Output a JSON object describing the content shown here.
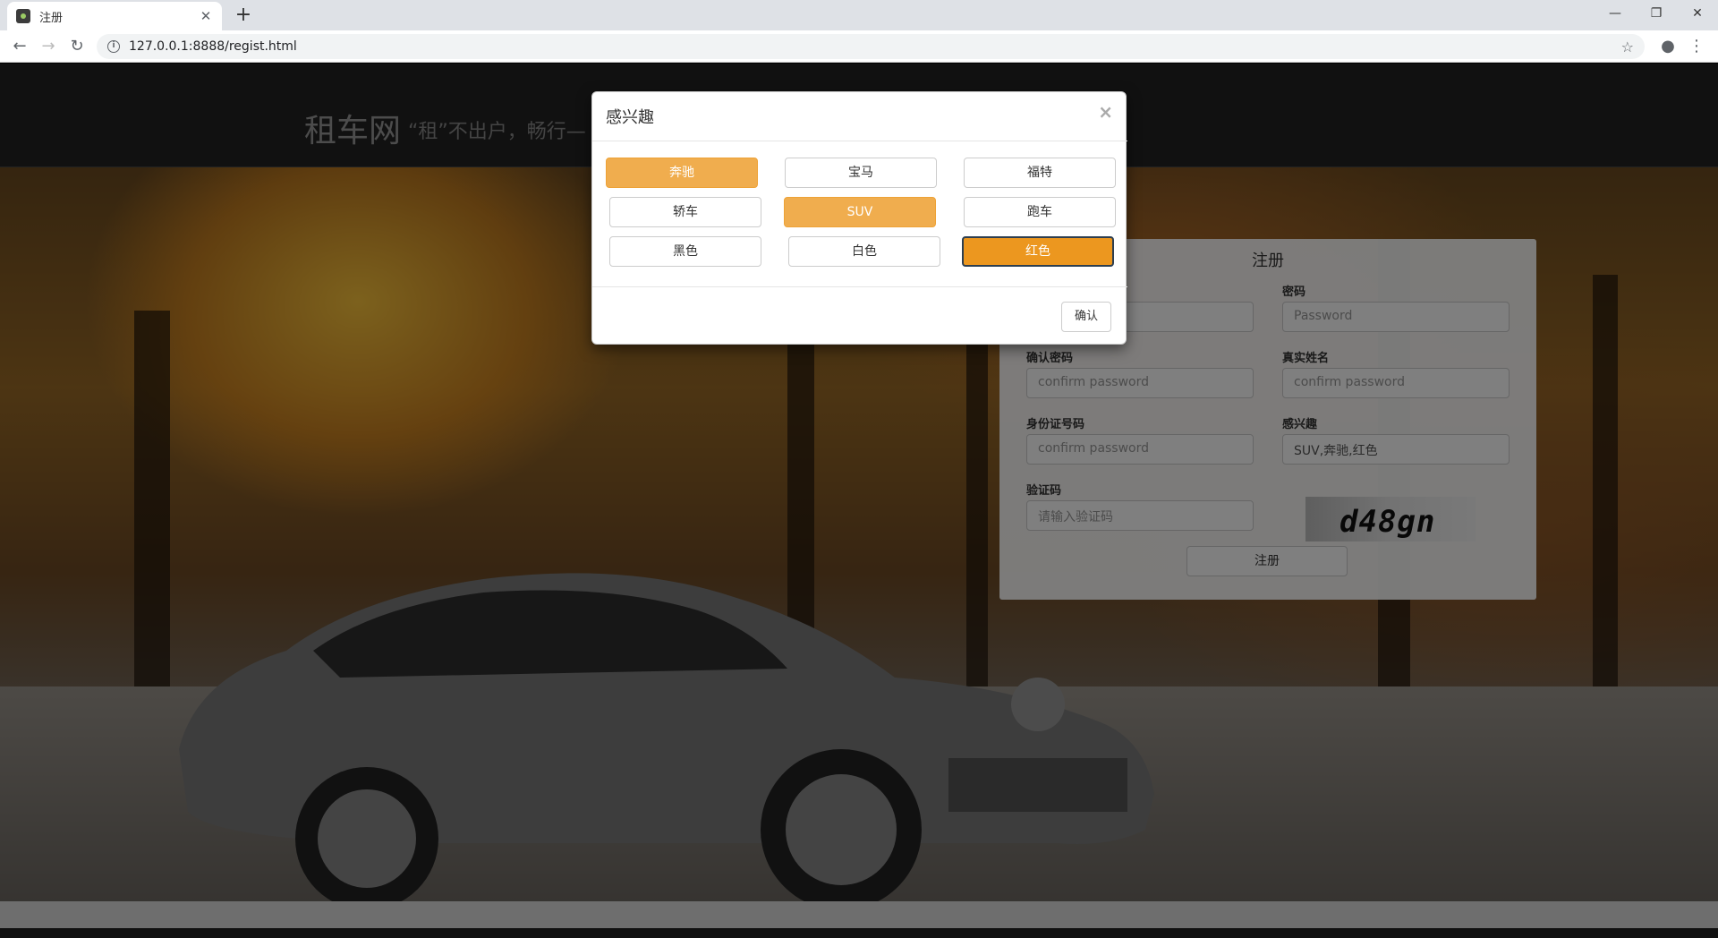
{
  "browser": {
    "tab_title": "注册",
    "url": "127.0.0.1:8888/regist.html"
  },
  "site": {
    "brand": "租车网",
    "slogan": "“租”不出户，畅行—"
  },
  "register": {
    "title": "注册",
    "password_label": "密码",
    "password_placeholder": "Password",
    "confirm_label": "确认密码",
    "confirm_placeholder": "confirm password",
    "realname_label": "真实姓名",
    "realname_placeholder": "confirm password",
    "idcard_label": "身份证号码",
    "idcard_placeholder": "confirm password",
    "interest_label": "感兴趣",
    "interest_value": "SUV,奔驰,红色",
    "captcha_label": "验证码",
    "captcha_placeholder": "请输入验证码",
    "captcha_text": "d48gn",
    "submit_label": "注册"
  },
  "modal": {
    "title": "感兴趣",
    "close": "×",
    "options": [
      {
        "label": "奔驰",
        "state": "active"
      },
      {
        "label": "宝马",
        "state": "normal"
      },
      {
        "label": "福特",
        "state": "normal"
      },
      {
        "label": "轿车",
        "state": "normal"
      },
      {
        "label": "SUV",
        "state": "active"
      },
      {
        "label": "跑车",
        "state": "normal"
      },
      {
        "label": "黑色",
        "state": "normal"
      },
      {
        "label": "白色",
        "state": "normal"
      },
      {
        "label": "红色",
        "state": "focused"
      }
    ],
    "confirm_label": "确认"
  },
  "colors": {
    "accent": "#f0ad4e",
    "accent_dark": "#ec971f"
  }
}
